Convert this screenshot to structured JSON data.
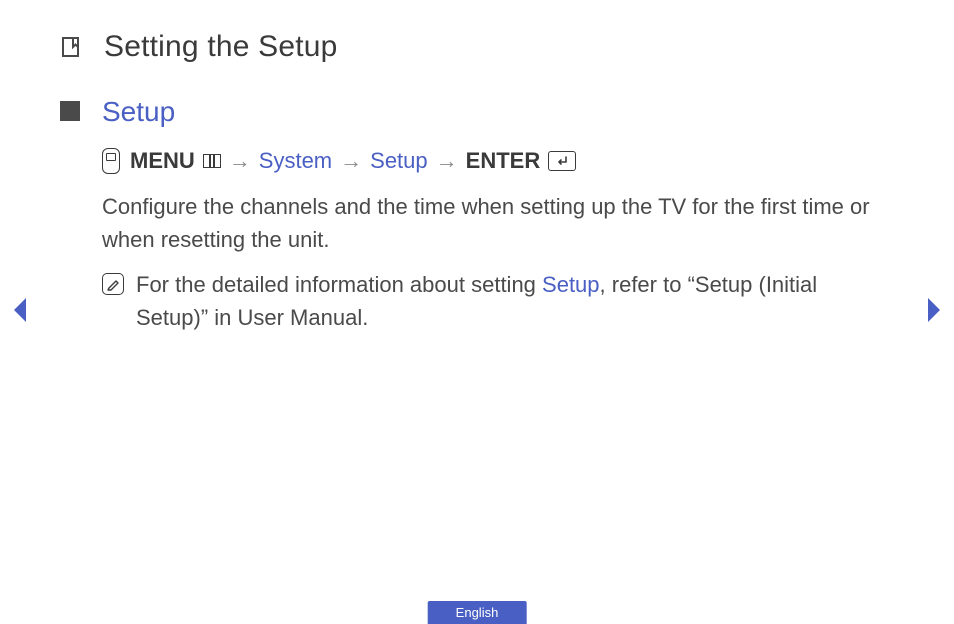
{
  "page": {
    "title": "Setting the Setup"
  },
  "section": {
    "title": "Setup"
  },
  "menuPath": {
    "menu": "MENU",
    "system": "System",
    "setup": "Setup",
    "enter": "ENTER",
    "arrow": "→"
  },
  "body": {
    "paragraph": "Configure the channels and the time when setting up the TV for the first time or when resetting the unit."
  },
  "note": {
    "prefix": "For the detailed information about setting ",
    "highlight": "Setup",
    "suffix": ", refer to “Setup (Initial Setup)” in User Manual."
  },
  "footer": {
    "language": "English"
  }
}
